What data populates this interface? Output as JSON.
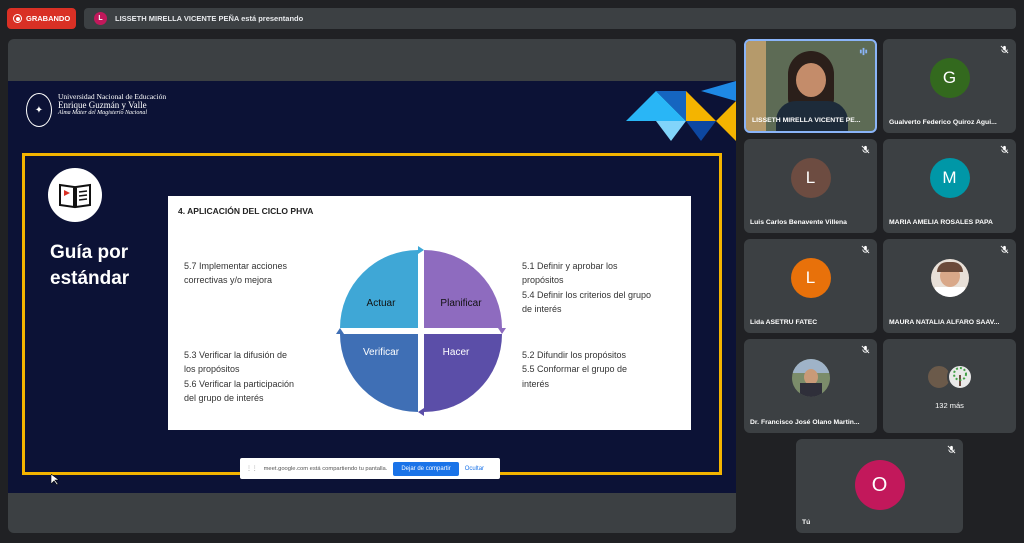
{
  "recording": {
    "label": "GRABANDO"
  },
  "presenter_bar": {
    "initial": "L",
    "text": "LISSETH MIRELLA VICENTE PEÑA está presentando"
  },
  "slide": {
    "logo": {
      "line1": "Universidad Nacional de Educación",
      "line2": "Enrique Guzmán y Valle",
      "line3": "Alma Máter del Magisterio Nacional"
    },
    "guide_title_1": "Guía por",
    "guide_title_2": "estándar",
    "heading": "4.   APLICACIÓN DEL CICLO PHVA",
    "left_top": "5.7 Implementar acciones\ncorrectivas y/o mejora",
    "left_bottom": "5.3 Verificar la difusión de\nlos propósitos\n5.6 Verificar la participación\ndel grupo de interés",
    "right_top": "5.1 Definir y aprobar los\npropósitos\n5.4 Definir los criterios del grupo\nde interés",
    "right_bottom": "5.2 Difundir los propósitos\n5.5 Conformar el grupo de\ninterés",
    "cycle": {
      "actuar": "Actuar",
      "planificar": "Planificar",
      "verificar": "Verificar",
      "hacer": "Hacer"
    },
    "cycle_colors": {
      "actuar": "#3fa7d6",
      "planificar": "#8e6bbf",
      "verificar": "#3f6fb5",
      "hacer": "#5b4ea8"
    }
  },
  "share_notice": {
    "text": "meet.google.com está compartiendo tu pantalla.",
    "stop_label": "Dejar de compartir",
    "hide_label": "Ocultar"
  },
  "participants": [
    {
      "name": "LISSETH MIRELLA VICENTE PE...",
      "initial": "",
      "color": ""
    },
    {
      "name": "Gualverto Federico Quiroz Agui...",
      "initial": "G",
      "color": "#33691e"
    },
    {
      "name": "Luis Carlos Benavente Villena",
      "initial": "L",
      "color": "#6d4c41"
    },
    {
      "name": "MARIA AMELIA ROSALES PAPA",
      "initial": "M",
      "color": "#0097a7"
    },
    {
      "name": "Lida ASETRU FATEC",
      "initial": "L",
      "color": "#e8710a"
    },
    {
      "name": "MAURA NATALIA ALFARO SAAV...",
      "initial": "",
      "color": ""
    },
    {
      "name": "Dr. Francisco José Olano Martin...",
      "initial": "",
      "color": ""
    },
    {
      "name": "132 más",
      "initial": "",
      "color": ""
    }
  ],
  "self": {
    "name": "Tú",
    "initial": "O",
    "color": "#c2185b"
  }
}
